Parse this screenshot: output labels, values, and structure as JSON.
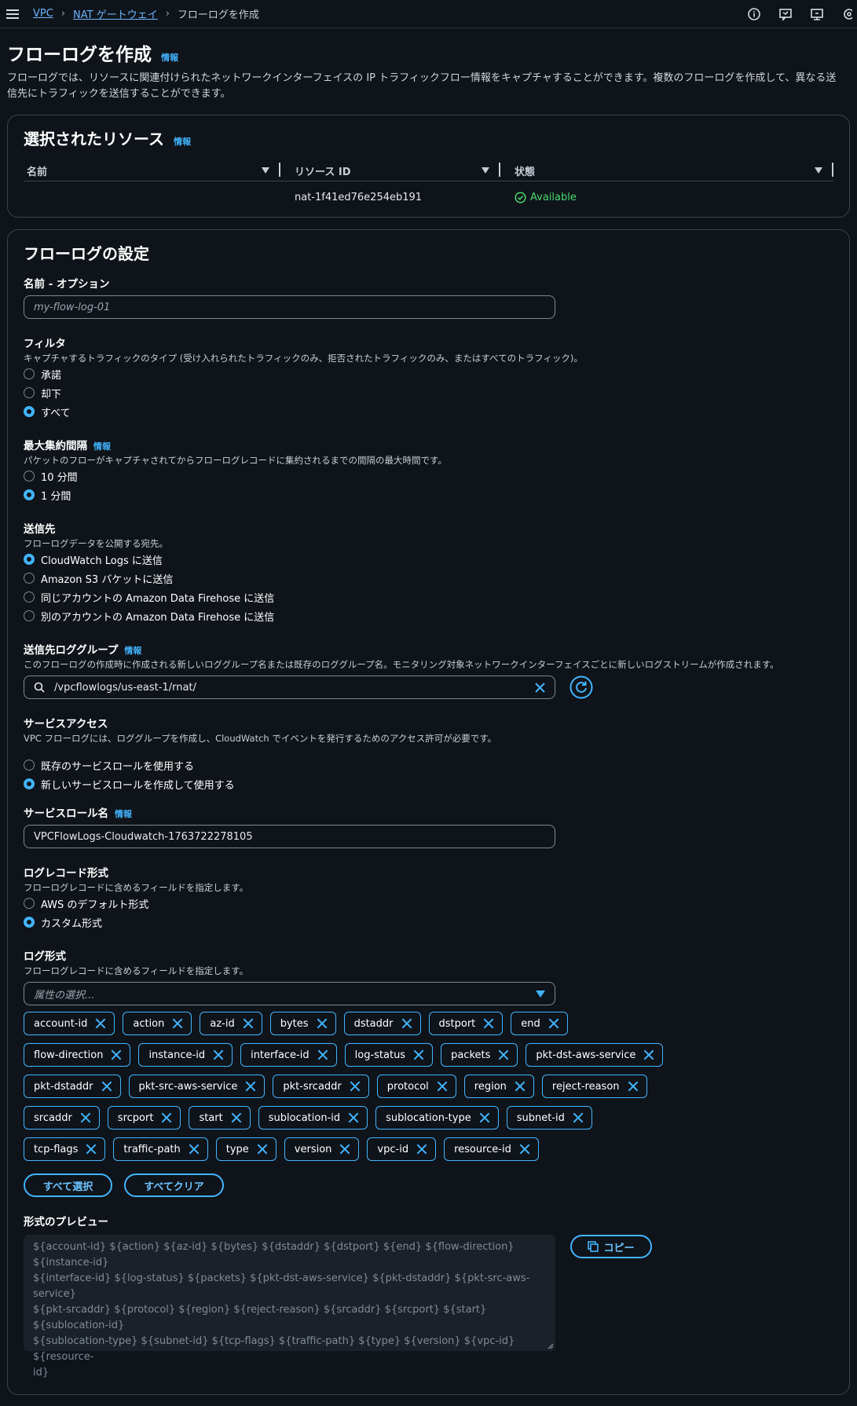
{
  "breadcrumb": {
    "vpc": "VPC",
    "nat": "NAT ゲートウェイ",
    "current": "フローログを作成"
  },
  "page": {
    "title": "フローログを作成",
    "info": "情報",
    "description": "フローログでは、リソースに関連付けられたネットワークインターフェイスの IP トラフィックフロー情報をキャプチャすることができます。複数のフローログを作成して、異なる送信先にトラフィックを送信することができます。"
  },
  "resources": {
    "title": "選択されたリソース",
    "info": "情報",
    "columns": [
      "名前",
      "リソース ID",
      "状態"
    ],
    "row": {
      "name": "",
      "resource_id": "nat-1f41ed76e254eb191",
      "status": "Available"
    }
  },
  "settings": {
    "title": "フローログの設定",
    "name_label": "名前 - オプション",
    "name_placeholder": "my-flow-log-01",
    "filter": {
      "label": "フィルタ",
      "desc": "キャプチャするトラフィックのタイプ (受け入れられたトラフィックのみ、拒否されたトラフィックのみ、またはすべてのトラフィック)。",
      "options": [
        "承諾",
        "却下",
        "すべて"
      ],
      "selected": 2
    },
    "interval": {
      "label": "最大集約間隔",
      "info": "情報",
      "desc": "パケットのフローがキャプチャされてからフローログレコードに集約されるまでの間隔の最大時間です。",
      "options": [
        "10 分間",
        "1 分間"
      ],
      "selected": 1
    },
    "destination": {
      "label": "送信先",
      "desc": "フローログデータを公開する宛先。",
      "options": [
        "CloudWatch Logs に送信",
        "Amazon S3 バケットに送信",
        "同じアカウントの Amazon Data Firehose に送信",
        "別のアカウントの Amazon Data Firehose に送信"
      ],
      "selected": 0
    },
    "log_group": {
      "label": "送信先ロググループ",
      "info": "情報",
      "desc": "このフローログの作成時に作成される新しいロググループ名または既存のロググループ名。モニタリング対象ネットワークインターフェイスごとに新しいログストリームが作成されます。",
      "value": "/vpcflowlogs/us-east-1/rnat/"
    },
    "service_access": {
      "label": "サービスアクセス",
      "desc": "VPC フローログには、ロググループを作成し、CloudWatch でイベントを発行するためのアクセス許可が必要です。",
      "options": [
        "既存のサービスロールを使用する",
        "新しいサービスロールを作成して使用する"
      ],
      "selected": 1
    },
    "role_name": {
      "label": "サービスロール名",
      "info": "情報",
      "value": "VPCFlowLogs-Cloudwatch-1763722278105"
    },
    "record_format": {
      "label": "ログレコード形式",
      "desc": "フローログレコードに含めるフィールドを指定します。",
      "options": [
        "AWS のデフォルト形式",
        "カスタム形式"
      ],
      "selected": 1
    },
    "log_format": {
      "label": "ログ形式",
      "desc": "フローログレコードに含めるフィールドを指定します。",
      "placeholder": "属性の選択...",
      "tags": [
        "account-id",
        "action",
        "az-id",
        "bytes",
        "dstaddr",
        "dstport",
        "end",
        "flow-direction",
        "instance-id",
        "interface-id",
        "log-status",
        "packets",
        "pkt-dst-aws-service",
        "pkt-dstaddr",
        "pkt-src-aws-service",
        "pkt-srcaddr",
        "protocol",
        "region",
        "reject-reason",
        "srcaddr",
        "srcport",
        "start",
        "sublocation-id",
        "sublocation-type",
        "subnet-id",
        "tcp-flags",
        "traffic-path",
        "type",
        "version",
        "vpc-id",
        "resource-id"
      ]
    },
    "select_all": "すべて選択",
    "clear_all": "すべてクリア",
    "preview": {
      "label": "形式のプレビュー",
      "lines": [
        "${account-id} ${action} ${az-id} ${bytes} ${dstaddr} ${dstport} ${end} ${flow-direction} ${instance-id}",
        "${interface-id} ${log-status} ${packets} ${pkt-dst-aws-service} ${pkt-dstaddr} ${pkt-src-aws-service}",
        "${pkt-srcaddr} ${protocol} ${region} ${reject-reason} ${srcaddr} ${srcport} ${start} ${sublocation-id}",
        "${sublocation-type} ${subnet-id} ${tcp-flags} ${traffic-path} ${type} ${version} ${vpc-id} ${resource-",
        "id}"
      ]
    },
    "copy": "コピー"
  }
}
